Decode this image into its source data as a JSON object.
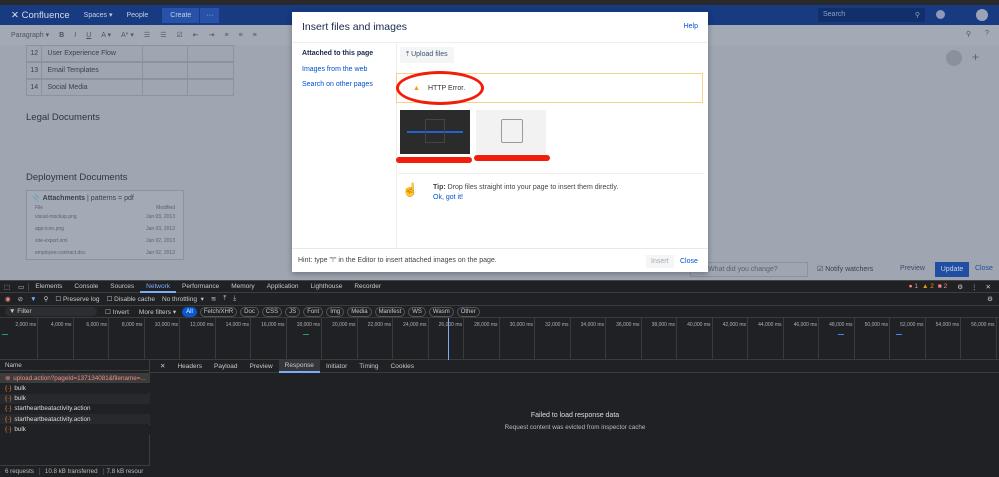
{
  "confluence": {
    "logo": "Confluence",
    "nav": [
      "Spaces",
      "People"
    ],
    "create": "Create",
    "more": "···",
    "search_placeholder": "Search",
    "toolbar": {
      "paragraph": "Paragraph"
    },
    "table_rows": [
      {
        "n": "12",
        "title": "User Experience Flow"
      },
      {
        "n": "13",
        "title": "Email Templates"
      },
      {
        "n": "14",
        "title": "Social Media"
      }
    ],
    "headings": [
      "Legal Documents",
      "Deployment Documents"
    ],
    "attachments": {
      "title": "Attachments",
      "filter": "| patterns = pdf",
      "col_file": "File",
      "col_modified": "Modified",
      "files": [
        {
          "name": "visual-mockup.png",
          "date": "Jan 03, 2013"
        },
        {
          "name": "app-icon.png",
          "date": "Jan 03, 2013"
        },
        {
          "name": "site-export.xml",
          "date": "Jan 02, 2013"
        },
        {
          "name": "employee-contract.doc",
          "date": "Jan 02, 2013"
        }
      ]
    },
    "bottom": {
      "change_placeholder": "What did you change?",
      "notify": "Notify watchers",
      "preview": "Preview",
      "update": "Update",
      "close": "Close"
    }
  },
  "modal": {
    "title": "Insert files and images",
    "help": "Help",
    "nav": [
      "Attached to this page",
      "Images from the web",
      "Search on other pages"
    ],
    "upload": "Upload files",
    "error": "HTTP Error.",
    "tip_label": "Tip:",
    "tip": "Drop files straight into your page to insert them directly.",
    "tip_ok": "Ok, got it!",
    "hint": "Hint: type \"!\" in the Editor to insert attached images on the page.",
    "insert": "Insert",
    "close": "Close"
  },
  "devtools": {
    "tabs": [
      "Elements",
      "Console",
      "Sources",
      "Network",
      "Performance",
      "Memory",
      "Application",
      "Lighthouse",
      "Recorder"
    ],
    "active_tab": "Network",
    "status": {
      "errors": "1",
      "warnings": "2",
      "issues": "2"
    },
    "toolbar": {
      "preserve_log": "Preserve log",
      "disable_cache": "Disable cache",
      "throttling": "No throttling"
    },
    "filter": {
      "placeholder": "Filter",
      "invert": "Invert",
      "more_filters": "More filters",
      "types": [
        "All",
        "Fetch/XHR",
        "Doc",
        "CSS",
        "JS",
        "Font",
        "Img",
        "Media",
        "Manifest",
        "WS",
        "Wasm",
        "Other"
      ]
    },
    "timeline": [
      "2,000 ms",
      "4,000 ms",
      "6,000 ms",
      "8,000 ms",
      "10,000 ms",
      "12,000 ms",
      "14,000 ms",
      "16,000 ms",
      "18,000 ms",
      "20,000 ms",
      "22,000 ms",
      "24,000 ms",
      "26,000 ms",
      "28,000 ms",
      "30,000 ms",
      "32,000 ms",
      "34,000 ms",
      "36,000 ms",
      "38,000 ms",
      "40,000 ms",
      "42,000 ms",
      "44,000 ms",
      "46,000 ms",
      "48,000 ms",
      "50,000 ms",
      "52,000 ms",
      "54,000 ms",
      "56,000 ms"
    ],
    "name_header": "Name",
    "requests": [
      {
        "name": "upload.action?pageId=137134081&filename=...",
        "error": true
      },
      {
        "name": "bulk"
      },
      {
        "name": "bulk"
      },
      {
        "name": "startheartbeatactivity.action"
      },
      {
        "name": "startheartbeatactivity.action"
      },
      {
        "name": "bulk"
      }
    ],
    "detail_tabs": [
      "Headers",
      "Payload",
      "Preview",
      "Response",
      "Initiator",
      "Timing",
      "Cookies"
    ],
    "active_detail": "Response",
    "message": "Failed to load response data",
    "submessage": "Request content was evicted from inspector cache",
    "summary": {
      "requests": "6 requests",
      "transferred": "10.8 kB transferred",
      "resources": "7.8 kB resour"
    }
  }
}
